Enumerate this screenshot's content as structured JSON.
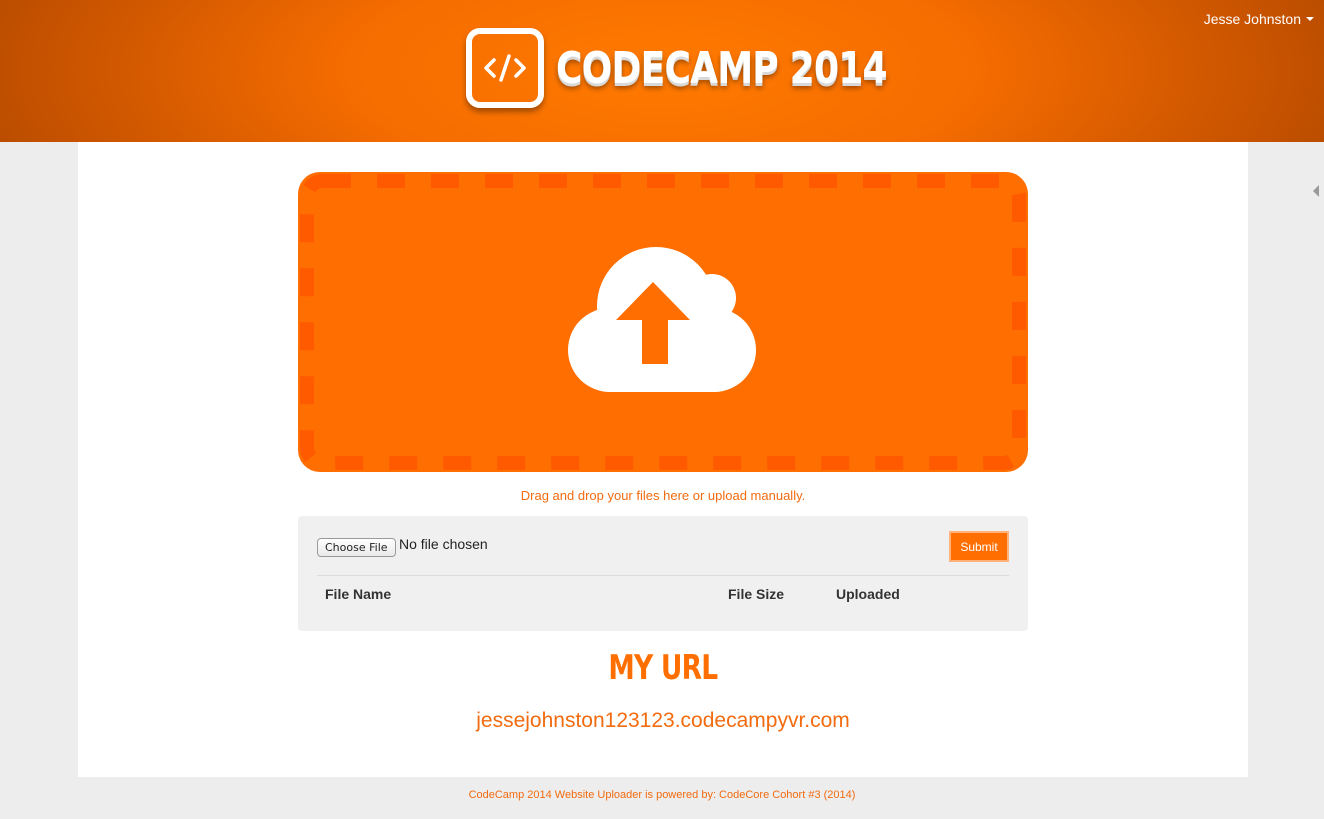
{
  "header": {
    "app_title": "CODECAMP 2014",
    "user_name": "Jesse Johnston",
    "logo_icon": "code-brackets-icon"
  },
  "dropzone": {
    "icon": "cloud-upload-icon",
    "hint": "Drag and drop your files here or upload manually."
  },
  "upload": {
    "choose_file_label": "Choose File",
    "file_status": "No file chosen",
    "submit_label": "Submit",
    "columns": [
      "File Name",
      "File Size",
      "Uploaded"
    ]
  },
  "my_url": {
    "title": "MY URL",
    "value": "jessejohnston123123.codecampyvr.com"
  },
  "footer": {
    "text": "CodeCamp 2014 Website Uploader is powered by: CodeCore Cohort #3 (2014)"
  },
  "colors": {
    "brand_orange": "#ff6e00",
    "link_orange": "#f26b10",
    "panel_gray": "#f0f0f0",
    "page_bg": "#ededed"
  }
}
